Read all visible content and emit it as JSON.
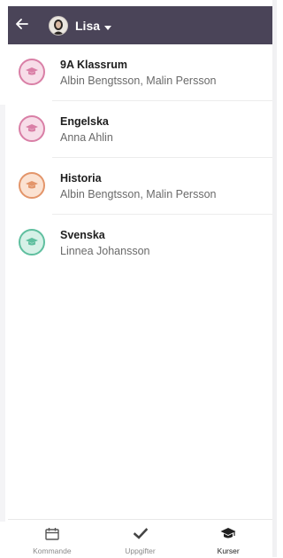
{
  "header": {
    "user_name": "Lisa",
    "background_color": "#4a4458"
  },
  "courses": [
    {
      "title": "9A Klassrum",
      "teachers": "Albin Bengtsson, Malin Persson",
      "color": "#d97fa6",
      "fill": "#f7dde8"
    },
    {
      "title": "Engelska",
      "teachers": "Anna Ahlin",
      "color": "#d97fa6",
      "fill": "#f7dde8"
    },
    {
      "title": "Historia",
      "teachers": "Albin Bengtsson, Malin Persson",
      "color": "#e3956a",
      "fill": "#fbe2d2"
    },
    {
      "title": "Svenska",
      "teachers": "Linnea Johansson",
      "color": "#5fbf9f",
      "fill": "#d6f1e7"
    }
  ],
  "bottom_nav": [
    {
      "label": "Kommande",
      "icon": "calendar-icon",
      "active": false
    },
    {
      "label": "Uppgifter",
      "icon": "checkmark-icon",
      "active": false
    },
    {
      "label": "Kurser",
      "icon": "graduation-cap-icon",
      "active": true
    }
  ]
}
